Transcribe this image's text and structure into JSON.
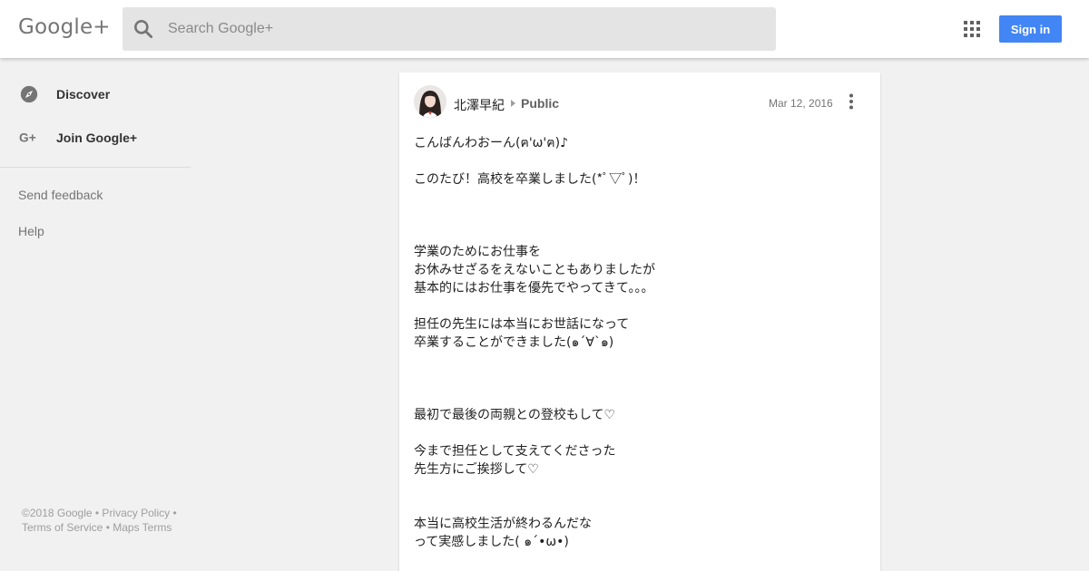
{
  "header": {
    "logo_text": "Google+",
    "search_placeholder": "Search Google+",
    "sign_in_label": "Sign in"
  },
  "sidebar": {
    "items": [
      {
        "label": "Discover",
        "icon": "compass-icon"
      },
      {
        "label": "Join Google+",
        "icon": "google-plus-icon"
      }
    ],
    "links": [
      "Send feedback",
      "Help"
    ],
    "footer": "©2018 Google • Privacy Policy • Terms of Service • Maps Terms"
  },
  "post": {
    "author": "北澤早紀",
    "visibility": "Public",
    "date": "Mar 12, 2016",
    "lines": [
      "こんばんわおーん(ฅ'ω'ฅ)♪",
      "",
      "このたび！高校を卒業しました(*ﾟ▽ﾟ)！",
      "",
      "",
      "",
      "学業のためにお仕事を",
      "お休みせざるをえないこともありましたが",
      "基本的にはお仕事を優先でやってきて。。。",
      "",
      "担任の先生には本当にお世話になって",
      "卒業することができました(๑´∀`๑)",
      "",
      "",
      "",
      "最初で最後の両親との登校もして♡",
      "",
      "今まで担任として支えてくださった",
      "先生方にご挨拶して♡",
      "",
      "",
      "本当に高校生活が終わるんだな",
      "って実感しました( ๑´•ω•)"
    ]
  },
  "colors": {
    "accent": "#4285f4",
    "background": "#f1f1f1"
  }
}
